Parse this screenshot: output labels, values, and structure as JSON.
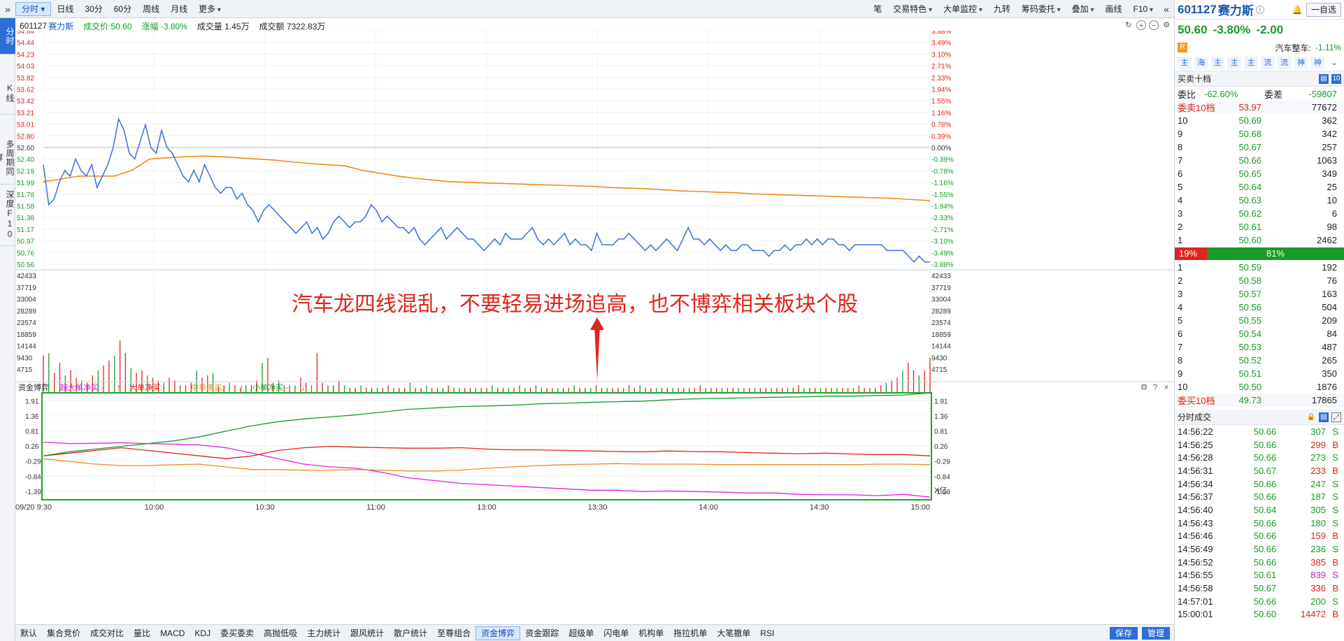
{
  "toolbar": {
    "tabs": [
      "分时",
      "日线",
      "30分",
      "60分",
      "周线",
      "月线",
      "更多"
    ],
    "right_items": [
      "笔",
      "交易特色",
      "大单监控",
      "九转",
      "筹码委托",
      "叠加",
      "画线",
      "F10"
    ]
  },
  "left_tabs": [
    "分时",
    "K线",
    "多周期同屏",
    "深度F10"
  ],
  "info": {
    "code": "601127",
    "name": "赛力斯",
    "price_label": "成交价 50.60",
    "change_label": "涨幅 -3.80%",
    "volume_label": "成交量 1.45万",
    "amount_label": "成交额 7322.83万"
  },
  "colors": {
    "up": "#e0241b",
    "down": "#1a9a2a",
    "price_line": "#3a6fd8",
    "avg_line": "#f08a1c",
    "panel_border": "#19a62a"
  },
  "chart_data": {
    "type": "line",
    "price_axis": {
      "left_ticks": [
        "54.64",
        "54.44",
        "54.23",
        "54.03",
        "53.82",
        "53.62",
        "53.42",
        "53.21",
        "53.01",
        "52.80",
        "52.60",
        "52.40",
        "52.19",
        "51.99",
        "51.78",
        "51.58",
        "51.38",
        "51.17",
        "50.97",
        "50.76",
        "50.56"
      ],
      "right_ticks": [
        "3.88%",
        "3.49%",
        "3.10%",
        "2.71%",
        "2.33%",
        "1.94%",
        "1.55%",
        "1.16%",
        "0.78%",
        "0.39%",
        "0.00%",
        "-0.39%",
        "-0.78%",
        "-1.16%",
        "-1.55%",
        "-1.94%",
        "-2.33%",
        "-2.71%",
        "-3.10%",
        "-3.49%",
        "-3.88%"
      ],
      "ylim": [
        50.56,
        54.64
      ]
    },
    "x_ticks": [
      "09/20 9:30",
      "10:00",
      "10:30",
      "11:00",
      "13:00",
      "13:30",
      "14:00",
      "14:30",
      "15:00"
    ],
    "price_series": [
      52.3,
      51.6,
      51.7,
      52.0,
      52.2,
      52.1,
      52.4,
      52.2,
      52.1,
      52.3,
      51.9,
      52.1,
      52.3,
      52.6,
      53.1,
      52.9,
      52.5,
      52.4,
      52.7,
      53.0,
      52.6,
      52.5,
      52.9,
      52.6,
      52.5,
      52.3,
      52.1,
      52.0,
      52.2,
      52.0,
      52.3,
      52.1,
      51.9,
      51.8,
      51.9,
      51.9,
      51.7,
      51.8,
      51.6,
      51.5,
      51.3,
      51.5,
      51.6,
      51.5,
      51.4,
      51.3,
      51.2,
      51.1,
      51.2,
      51.3,
      51.1,
      51.2,
      51.0,
      51.1,
      51.3,
      51.4,
      51.3,
      51.2,
      51.3,
      51.3,
      51.4,
      51.6,
      51.5,
      51.3,
      51.4,
      51.3,
      51.2,
      51.2,
      51.1,
      51.2,
      51.0,
      50.9,
      51.0,
      51.1,
      51.2,
      51.0,
      51.1,
      51.2,
      51.1,
      51.0,
      51.0,
      50.9,
      50.8,
      50.9,
      51.0,
      50.9,
      51.1,
      51.0,
      51.0,
      51.0,
      51.1,
      51.2,
      51.0,
      50.9,
      51.0,
      50.9,
      51.0,
      51.1,
      50.9,
      51.0,
      50.9,
      50.9,
      50.8,
      51.1,
      50.9,
      50.9,
      50.9,
      51.0,
      51.0,
      51.1,
      51.0,
      50.9,
      50.8,
      50.9,
      50.8,
      50.9,
      51.0,
      50.9,
      50.8,
      51.0,
      51.2,
      51.0,
      51.0,
      50.9,
      51.0,
      50.9,
      50.8,
      50.9,
      50.8,
      50.8,
      50.9,
      50.9,
      50.8,
      50.8,
      50.8,
      50.7,
      50.8,
      50.8,
      50.9,
      50.8,
      50.9,
      50.9,
      51.0,
      50.9,
      51.0,
      50.9,
      51.0,
      51.0,
      50.9,
      50.9,
      50.8,
      50.9,
      50.9,
      50.9,
      50.9,
      50.9,
      50.9,
      50.8,
      50.8,
      50.8,
      50.8,
      50.7,
      50.6,
      50.7,
      50.6,
      50.6
    ],
    "avg_series": [
      52.0,
      52.05,
      52.1,
      52.1,
      52.1,
      52.2,
      52.4,
      52.42,
      52.44,
      52.45,
      52.44,
      52.42,
      52.4,
      52.38,
      52.35,
      52.32,
      52.3,
      52.28,
      52.2,
      52.15,
      52.1,
      52.06,
      52.03,
      52.0,
      51.99,
      51.98,
      51.97,
      51.96,
      51.95,
      51.94,
      51.93,
      51.92,
      51.9,
      51.89,
      51.88,
      51.86,
      51.84,
      51.83,
      51.82,
      51.81,
      51.79,
      51.78,
      51.77,
      51.76,
      51.75,
      51.74,
      51.73,
      51.72,
      51.71,
      51.69,
      51.67
    ],
    "volume_axis": {
      "ticks": [
        "42433",
        "37719",
        "33004",
        "28289",
        "23574",
        "18859",
        "14144",
        "9430",
        "4715"
      ]
    },
    "volume_values": [
      15000,
      16000,
      8000,
      12000,
      7000,
      9000,
      6000,
      5000,
      4000,
      7000,
      9000,
      11000,
      13000,
      15000,
      21000,
      16000,
      10000,
      8000,
      9000,
      7000,
      6000,
      5000,
      4000,
      6000,
      5000,
      3000,
      3000,
      4000,
      9000,
      6000,
      7000,
      8000,
      3000,
      3000,
      4000,
      3000,
      2000,
      3000,
      3000,
      5000,
      12000,
      14000,
      4000,
      5000,
      3000,
      3000,
      3000,
      6000,
      4000,
      3000,
      16000,
      4000,
      3000,
      3000,
      5000,
      3000,
      2000,
      2000,
      3000,
      2000,
      2000,
      2000,
      2000,
      3000,
      2000,
      2000,
      2000,
      4000,
      2000,
      2000,
      3000,
      2000,
      2000,
      2000,
      3000,
      2000,
      2000,
      2000,
      2000,
      2000,
      2000,
      2000,
      3000,
      2000,
      2000,
      2000,
      2000,
      3000,
      2000,
      2000,
      3000,
      2000,
      2000,
      2000,
      2000,
      2000,
      2000,
      3000,
      2000,
      2000,
      2000,
      3000,
      2000,
      2000,
      2000,
      2000,
      2000,
      3000,
      2000,
      3000,
      2000,
      2000,
      2000,
      2000,
      2000,
      2000,
      2000,
      2000,
      2000,
      2000,
      3000,
      2000,
      2000,
      2000,
      2000,
      2000,
      2000,
      2000,
      2000,
      2000,
      2000,
      2000,
      2000,
      2000,
      2000,
      2000,
      2000,
      2000,
      3000,
      2000,
      2000,
      2000,
      2000,
      2000,
      2000,
      2000,
      2000,
      2000,
      2000,
      3000,
      2000,
      2000,
      2000,
      3000,
      4000,
      5000,
      6000,
      9000,
      12000,
      9000,
      7000,
      9000,
      14000
    ],
    "fund": {
      "title": "资金博弈",
      "legend": [
        "超大单净买:-",
        "大单净买:-",
        "中单净买:-",
        "小单净买:-"
      ],
      "legend_colors": [
        "#e020e0",
        "#e0241b",
        "#f08a1c",
        "#1a9a2a"
      ],
      "ticks": [
        "1.91",
        "1.36",
        "0.81",
        "0.26",
        "-0.29",
        "-0.84",
        "-1.39"
      ],
      "unit": "X亿",
      "ylim": [
        -1.7,
        2.2
      ],
      "series": [
        {
          "name": "超大单净买",
          "values": [
            0.4,
            0.35,
            0.36,
            0.38,
            0.35,
            0.33,
            0.3,
            0.2,
            0.0,
            -0.2,
            -0.4,
            -0.5,
            -0.55,
            -0.7,
            -0.9,
            -1.0,
            -1.1,
            -1.15,
            -1.2,
            -1.25,
            -1.3,
            -1.35,
            -1.35,
            -1.4,
            -1.38,
            -1.4,
            -1.42,
            -1.45,
            -1.45,
            -1.5,
            -1.52,
            -1.52,
            -1.55,
            -1.5,
            -1.6
          ]
        },
        {
          "name": "大单净买",
          "values": [
            -0.1,
            0.0,
            0.1,
            0.2,
            0.1,
            0.0,
            -0.1,
            -0.2,
            -0.1,
            0.1,
            0.2,
            0.25,
            0.22,
            0.2,
            0.18,
            0.18,
            0.2,
            0.15,
            0.12,
            0.12,
            0.1,
            0.08,
            0.06,
            0.05,
            0.08,
            0.06,
            0.05,
            0.02,
            0.0,
            -0.02,
            0.0,
            -0.03,
            -0.05,
            -0.05,
            -0.1
          ]
        },
        {
          "name": "中单净买",
          "values": [
            -0.2,
            -0.3,
            -0.4,
            -0.45,
            -0.45,
            -0.42,
            -0.4,
            -0.5,
            -0.6,
            -0.6,
            -0.62,
            -0.62,
            -0.6,
            -0.62,
            -0.65,
            -0.65,
            -0.62,
            -0.55,
            -0.5,
            -0.45,
            -0.42,
            -0.4,
            -0.38,
            -0.4,
            -0.4,
            -0.4,
            -0.42,
            -0.42,
            -0.42,
            -0.42,
            -0.42,
            -0.42,
            -0.4,
            -0.4,
            -0.42
          ]
        },
        {
          "name": "小单净买",
          "values": [
            -0.1,
            0.05,
            0.15,
            0.25,
            0.35,
            0.45,
            0.6,
            0.8,
            1.0,
            1.15,
            1.25,
            1.32,
            1.4,
            1.5,
            1.6,
            1.65,
            1.7,
            1.72,
            1.75,
            1.8,
            1.82,
            1.85,
            1.88,
            1.9,
            1.95,
            1.98,
            2.0,
            2.02,
            2.04,
            2.05,
            2.08,
            2.08,
            2.1,
            2.12,
            2.2
          ]
        }
      ]
    }
  },
  "annotation": "汽车龙四线混乱，不要轻易进场追高，也不博弈相关板块个股",
  "bottom_tabs": [
    "默认",
    "集合竞价",
    "成交对比",
    "量比",
    "MACD",
    "KDJ",
    "委买委卖",
    "高抛低吸",
    "主力统计",
    "跟风统计",
    "散户统计",
    "至尊组合",
    "资金博弈",
    "资金跟踪",
    "超级单",
    "闪电单",
    "机构单",
    "拖拉机单",
    "大笔撤单",
    "RSI"
  ],
  "bottom_right": [
    "保存",
    "管理"
  ],
  "right_panel": {
    "code": "601127",
    "name": "赛力斯",
    "self_select": "一自选",
    "price": "50.60",
    "change_pct": "-3.80%",
    "change": "-2.00",
    "sector_label": "汽车整车:",
    "sector_value": "-1.11%",
    "icons": [
      "主",
      "海",
      "主",
      "主",
      "主",
      "流",
      "流",
      "神",
      "神"
    ],
    "orderbook_title": "买卖十档",
    "ratio_label": "委比",
    "ratio_value": "-62.60%",
    "diff_label": "委差",
    "diff_value": "-59807",
    "ask_sum_label": "委卖10档",
    "ask_sum_price": "53.97",
    "ask_sum_vol": "77672",
    "asks": [
      {
        "lv": "10",
        "px": "50.69",
        "vol": "362"
      },
      {
        "lv": "9",
        "px": "50.68",
        "vol": "342"
      },
      {
        "lv": "8",
        "px": "50.67",
        "vol": "257"
      },
      {
        "lv": "7",
        "px": "50.66",
        "vol": "1063"
      },
      {
        "lv": "6",
        "px": "50.65",
        "vol": "349"
      },
      {
        "lv": "5",
        "px": "50.64",
        "vol": "25"
      },
      {
        "lv": "4",
        "px": "50.63",
        "vol": "10"
      },
      {
        "lv": "3",
        "px": "50.62",
        "vol": "6"
      },
      {
        "lv": "2",
        "px": "50.61",
        "vol": "98"
      },
      {
        "lv": "1",
        "px": "50.60",
        "vol": "2462"
      }
    ],
    "bar_left": "19%",
    "bar_right": "81%",
    "bar_left_fraction": 0.19,
    "bids": [
      {
        "lv": "1",
        "px": "50.59",
        "vol": "192"
      },
      {
        "lv": "2",
        "px": "50.58",
        "vol": "76"
      },
      {
        "lv": "3",
        "px": "50.57",
        "vol": "163"
      },
      {
        "lv": "4",
        "px": "50.56",
        "vol": "504"
      },
      {
        "lv": "5",
        "px": "50.55",
        "vol": "209"
      },
      {
        "lv": "6",
        "px": "50.54",
        "vol": "84"
      },
      {
        "lv": "7",
        "px": "50.53",
        "vol": "487"
      },
      {
        "lv": "8",
        "px": "50.52",
        "vol": "265"
      },
      {
        "lv": "9",
        "px": "50.51",
        "vol": "350"
      },
      {
        "lv": "10",
        "px": "50.50",
        "vol": "1876"
      }
    ],
    "bid_sum_label": "委买10档",
    "bid_sum_price": "49.73",
    "bid_sum_vol": "17865",
    "ticks_title": "分时成交",
    "ticks": [
      {
        "t": "14:56:22",
        "p": "50.66",
        "v": "307",
        "s": "S"
      },
      {
        "t": "14:56:25",
        "p": "50.66",
        "v": "299",
        "s": "B"
      },
      {
        "t": "14:56:28",
        "p": "50.66",
        "v": "273",
        "s": "S"
      },
      {
        "t": "14:56:31",
        "p": "50.67",
        "v": "233",
        "s": "B"
      },
      {
        "t": "14:56:34",
        "p": "50.66",
        "v": "247",
        "s": "S"
      },
      {
        "t": "14:56:37",
        "p": "50.66",
        "v": "187",
        "s": "S"
      },
      {
        "t": "14:56:40",
        "p": "50.64",
        "v": "305",
        "s": "S"
      },
      {
        "t": "14:56:43",
        "p": "50.66",
        "v": "180",
        "s": "S"
      },
      {
        "t": "14:56:46",
        "p": "50.66",
        "v": "159",
        "s": "B"
      },
      {
        "t": "14:56:49",
        "p": "50.66",
        "v": "236",
        "s": "S"
      },
      {
        "t": "14:56:52",
        "p": "50.66",
        "v": "385",
        "s": "B"
      },
      {
        "t": "14:56:55",
        "p": "50.61",
        "v": "839",
        "s": "S"
      },
      {
        "t": "14:56:58",
        "p": "50.67",
        "v": "336",
        "s": "B"
      },
      {
        "t": "14:57:01",
        "p": "50.66",
        "v": "200",
        "s": "S"
      },
      {
        "t": "15:00:01",
        "p": "50.60",
        "v": "14472",
        "s": "B"
      }
    ]
  }
}
